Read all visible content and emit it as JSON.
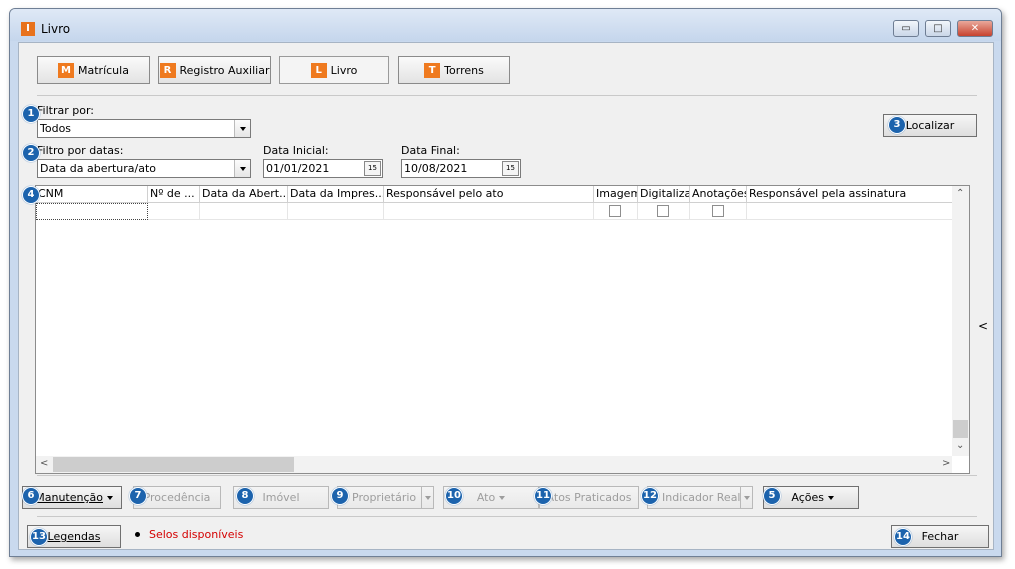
{
  "window": {
    "title": "Livro",
    "icon_letter": "I",
    "minimize": "▭",
    "maximize": "□",
    "close": "✕"
  },
  "tabs": [
    {
      "letter": "M",
      "label": "Matrícula"
    },
    {
      "letter": "R",
      "label": "Registro Auxiliar"
    },
    {
      "letter": "L",
      "label": "Livro"
    },
    {
      "letter": "T",
      "label": "Torrens"
    }
  ],
  "active_tab": "Livro",
  "badges": [
    "1",
    "2",
    "3",
    "4",
    "5",
    "6",
    "7",
    "8",
    "9",
    "10",
    "11",
    "12",
    "13",
    "14"
  ],
  "filter": {
    "label": "Filtrar por:",
    "value": "Todos"
  },
  "date_filter": {
    "label": "Filtro por datas:",
    "value": "Data da abertura/ato"
  },
  "date_start": {
    "label": "Data Inicial:",
    "value": "01/01/2021"
  },
  "date_end": {
    "label": "Data Final:",
    "value": "10/08/2021"
  },
  "calendar_glyph": "15",
  "localizar_label": "Localizar",
  "table": {
    "columns": [
      "CNM",
      "Nº de ...",
      "Data da Abert...",
      "Data da Impres...",
      "Responsável pelo ato",
      "Imagem",
      "Digitalizar",
      "Anotações",
      "Responsável pela assinatura"
    ]
  },
  "side_arrow": "<",
  "actions": {
    "manutencao": "Manutenção",
    "procedencia": "Procedência",
    "imovel": "Imóvel",
    "proprietario": "Proprietário",
    "ato": "Ato",
    "atos_praticados": "Atos Praticados",
    "indicador_real": "Indicador Real",
    "acoes": "Ações"
  },
  "footer": {
    "legendas": "Legendas",
    "selos": "Selos disponíveis",
    "fechar": "Fechar"
  },
  "colors": {
    "accent_orange": "#ef7a1f",
    "badge_blue": "#1c63ad",
    "selos_red": "#d40000"
  }
}
